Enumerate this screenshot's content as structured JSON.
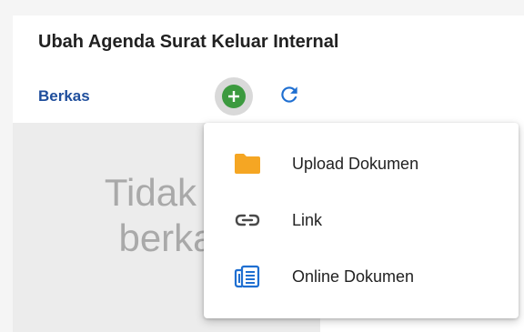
{
  "header": {
    "title": "Ubah Agenda Surat Keluar Internal"
  },
  "files": {
    "section_label": "Berkas",
    "add_icon": "add-circle-icon",
    "refresh_icon": "refresh-icon",
    "empty_text_line1": "Tidak a",
    "empty_text_line2": "berka"
  },
  "menu": {
    "items": [
      {
        "label": "Upload Dokumen",
        "icon": "folder-icon",
        "color": "#f5a623"
      },
      {
        "label": "Link",
        "icon": "link-icon",
        "color": "#4a4a4a"
      },
      {
        "label": "Online Dokumen",
        "icon": "online-document-icon",
        "color": "#1f6fd1"
      }
    ]
  },
  "colors": {
    "accent_blue": "#1f4e9c",
    "add_green": "#3c9a3f",
    "refresh_blue": "#1f6fd1"
  }
}
